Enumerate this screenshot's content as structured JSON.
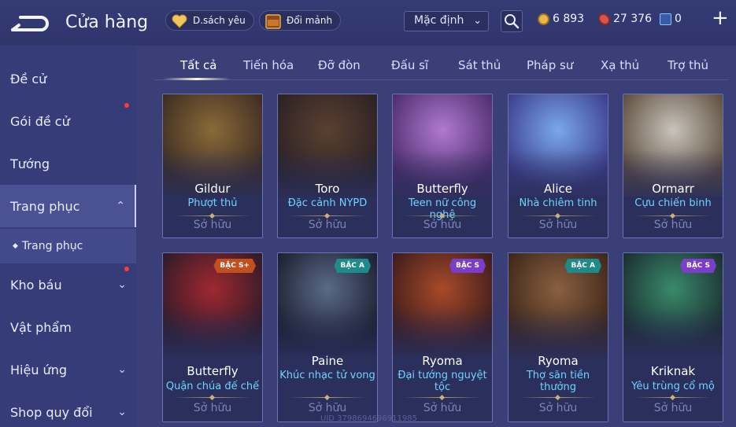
{
  "header": {
    "title": "Cửa hàng",
    "favorites_label": "D.sách yêu",
    "exchange_label": "Đổi mảnh",
    "sort_value": "Mặc định",
    "currencies": [
      {
        "name": "gold-coin-icon",
        "value": "6 893",
        "color": "#e8b64a"
      },
      {
        "name": "voucher-icon",
        "value": "27 376",
        "color": "#d9534a"
      },
      {
        "name": "ticket-icon",
        "value": "0",
        "color": "#7fc6ff"
      }
    ]
  },
  "sidebar": {
    "items": [
      {
        "label": "Đề cử"
      },
      {
        "label": "Gói đề cử"
      },
      {
        "label": "Tướng"
      },
      {
        "label": "Trang phục"
      },
      {
        "label": "Trang phục"
      },
      {
        "label": "Kho báu"
      },
      {
        "label": "Vật phẩm"
      },
      {
        "label": "Hiệu ứng"
      },
      {
        "label": "Shop quy đổi"
      }
    ]
  },
  "tabs": [
    "Tất cả",
    "Tiến hóa",
    "Đỡ đòn",
    "Đấu sĩ",
    "Sát thủ",
    "Pháp sư",
    "Xạ thủ",
    "Trợ thủ"
  ],
  "cards": [
    {
      "hero": "Gildur",
      "skin": "Phượt thủ",
      "status": "Sở hữu",
      "badge": "",
      "art": [
        "#8a6a3a",
        "#3a2a20"
      ]
    },
    {
      "hero": "Toro",
      "skin": "Đặc cảnh NYPD",
      "status": "Sở hữu",
      "badge": "",
      "art": [
        "#5a4030",
        "#2a2024"
      ]
    },
    {
      "hero": "Butterfly",
      "skin": "Teen nữ công nghệ",
      "status": "Sở hữu",
      "badge": "",
      "art": [
        "#b07ad0",
        "#4a2a6a"
      ]
    },
    {
      "hero": "Alice",
      "skin": "Nhà chiêm tinh",
      "status": "Sở hữu",
      "badge": "",
      "art": [
        "#7aa8e8",
        "#3a3a8a"
      ]
    },
    {
      "hero": "Ormarr",
      "skin": "Cựu chiến binh",
      "status": "Sở hữu",
      "badge": "",
      "art": [
        "#c8c4bc",
        "#5a4a3a"
      ]
    },
    {
      "hero": "Butterfly",
      "skin": "Quận chúa đế chế",
      "status": "Sở hữu",
      "badge": "BẬC S+",
      "art": [
        "#a02830",
        "#2a1a28"
      ]
    },
    {
      "hero": "Paine",
      "skin": "Khúc nhạc tử vong",
      "status": "Sở hữu",
      "badge": "BẬC A",
      "art": [
        "#5a6a8a",
        "#1a1c2a"
      ]
    },
    {
      "hero": "Ryoma",
      "skin": "Đại tướng nguyệt tộc",
      "status": "Sở hữu",
      "badge": "BẬC S",
      "art": [
        "#a84a2a",
        "#3a1a1a"
      ]
    },
    {
      "hero": "Ryoma",
      "skin": "Thợ săn tiền thưởng",
      "status": "Sở hữu",
      "badge": "BẬC A",
      "art": [
        "#8a6040",
        "#3a2418"
      ]
    },
    {
      "hero": "Kriknak",
      "skin": "Yêu trùng cổ mộ",
      "status": "Sở hữu",
      "badge": "BẬC S",
      "art": [
        "#3a8a6a",
        "#1a2a30"
      ]
    }
  ],
  "badge_colors": {
    "BẬC S+": "#c0501e",
    "BẬC A": "#1e8a8a",
    "BẬC S": "#7a3ec8"
  },
  "uid_text": "UID 3798694696911985"
}
